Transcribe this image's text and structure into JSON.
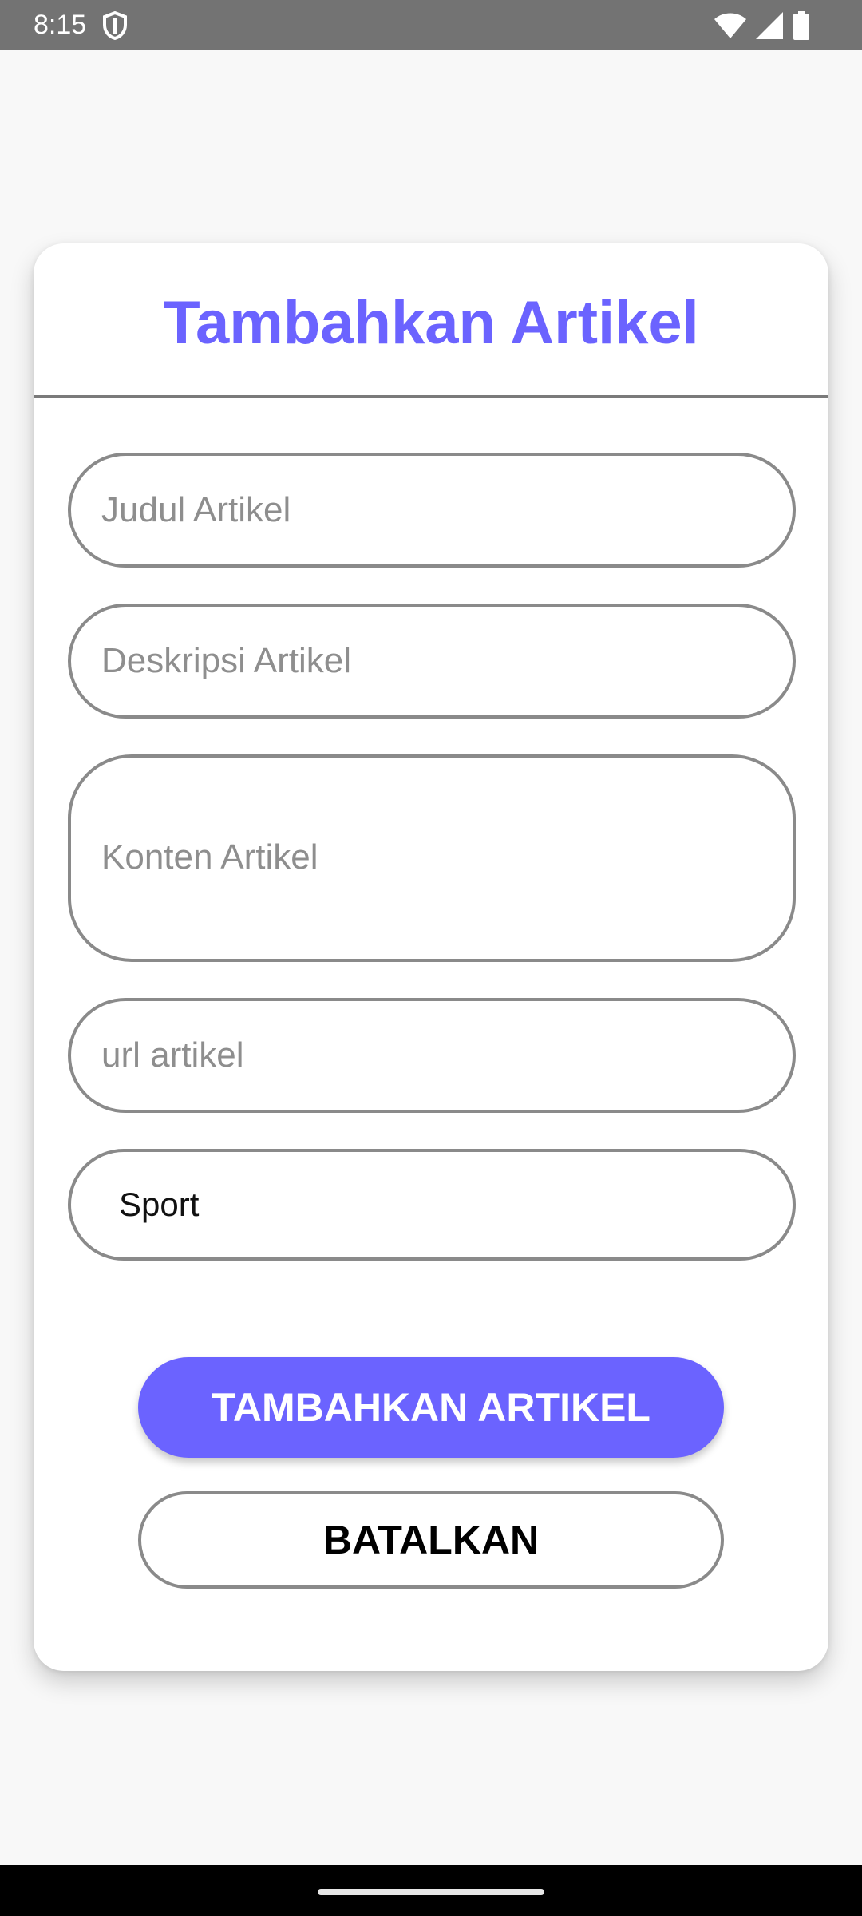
{
  "status_bar": {
    "time": "8:15",
    "icons": [
      "shield-icon",
      "wifi-icon",
      "signal-icon",
      "battery-icon"
    ]
  },
  "form": {
    "title": "Tambahkan Artikel",
    "fields": {
      "judul": {
        "placeholder": "Judul Artikel",
        "value": ""
      },
      "deskripsi": {
        "placeholder": "Deskripsi Artikel",
        "value": ""
      },
      "konten": {
        "placeholder": "Konten Artikel",
        "value": ""
      },
      "url": {
        "placeholder": "url artikel",
        "value": ""
      },
      "kategori": {
        "selected": "Sport"
      }
    },
    "buttons": {
      "submit_label": "TAMBAHKAN ARTIKEL",
      "cancel_label": "BATALKAN"
    }
  },
  "colors": {
    "accent": "#6b63ff",
    "status_bar": "#737373",
    "background": "#f8f8f8",
    "border": "#8a8a8a",
    "nav_bar": "#000000"
  }
}
